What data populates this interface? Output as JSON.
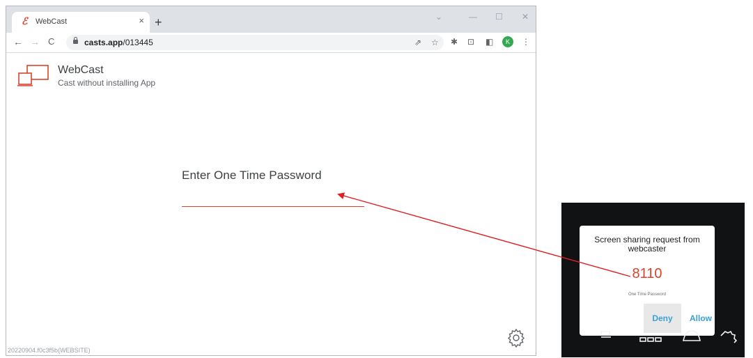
{
  "browser": {
    "tab": {
      "title": "WebCast",
      "favicon": "ℰ",
      "close": "×"
    },
    "new_tab": "+",
    "window_controls": {
      "minimize": "—",
      "maximize": "☐",
      "close": "✕",
      "tabsearch": "⌄"
    },
    "nav": {
      "back": "←",
      "forward": "→",
      "reload": "C"
    },
    "address": {
      "host": "casts.app",
      "path": "/013445"
    },
    "toolbar_icons": {
      "share": "⇗",
      "bookmark": "☆",
      "extensions": "✱",
      "cast": "⊡",
      "sidepanel": "◧",
      "menu": "⋮"
    },
    "avatar_letter": "K"
  },
  "page": {
    "app_name": "WebCast",
    "tagline": "Cast without installing App",
    "otp_heading": "Enter One Time Password",
    "otp_input_value": "",
    "version": "20220904.f0c3f5b(WEBSITE)"
  },
  "tv": {
    "request_title": "Screen sharing request from webcaster",
    "otp": "8110",
    "otp_label": "One Time Password",
    "deny": "Deny",
    "allow": "Allow"
  },
  "colors": {
    "accent": "#d9432c",
    "arrow": "#e02020",
    "tv_button": "#3aa0d6"
  }
}
